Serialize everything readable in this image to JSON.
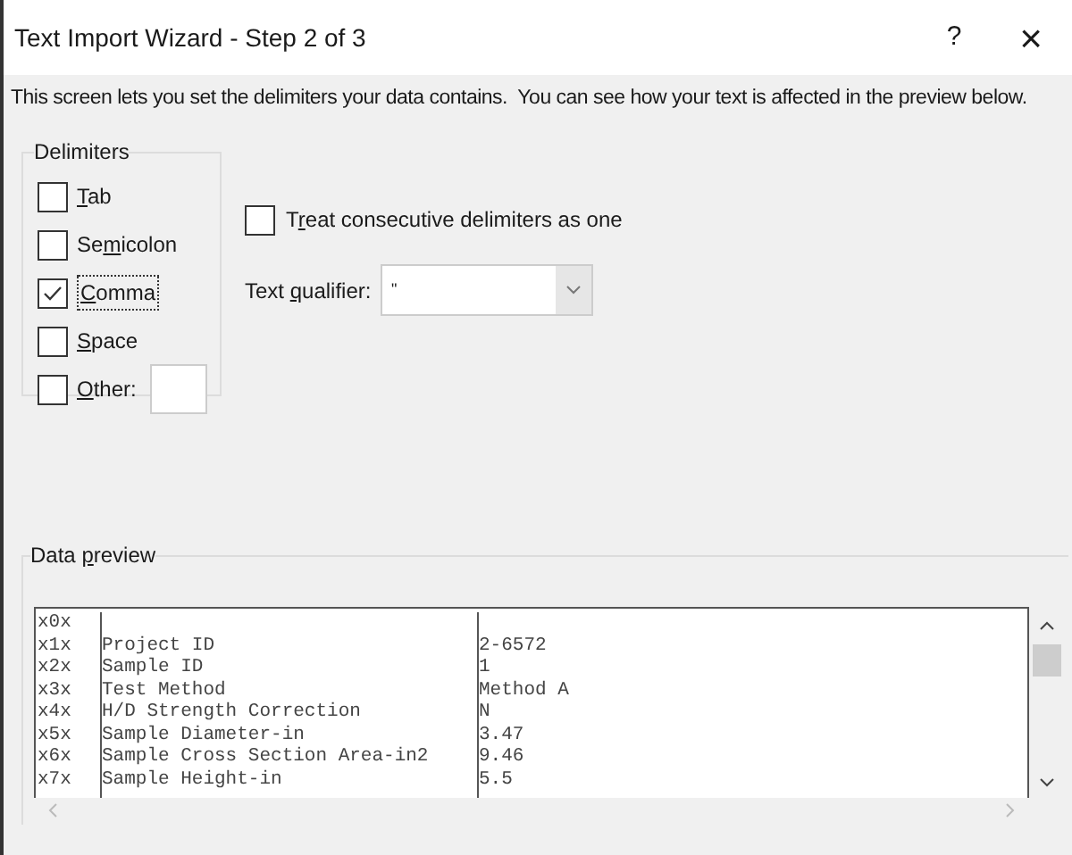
{
  "window": {
    "title": "Text Import Wizard - Step 2 of 3",
    "help": "?",
    "close": "×"
  },
  "description": "This screen lets you set the delimiters your data contains.  You can see how your text is affected in the preview below.",
  "delimiters": {
    "title": "Delimiters",
    "items": [
      {
        "key": "T",
        "after": "ab",
        "checked": false,
        "kind": "plain"
      },
      {
        "before": "Se",
        "key": "m",
        "after": "icolon",
        "checked": false,
        "kind": "plain"
      },
      {
        "key": "C",
        "after": "omma",
        "checked": true,
        "kind": "plain"
      },
      {
        "key": "S",
        "after": "pace",
        "checked": false,
        "kind": "plain"
      },
      {
        "key": "O",
        "after": "ther:",
        "checked": false,
        "kind": "with_field"
      }
    ]
  },
  "treat_consecutive": {
    "before": "T",
    "key": "r",
    "after": "eat consecutive delimiters as one",
    "checked": false
  },
  "text_qualifier": {
    "before": "Text ",
    "key": "q",
    "after": "ualifier:",
    "value": "\""
  },
  "preview": {
    "before": "Data ",
    "key": "p",
    "after": "review",
    "rows": [
      [
        "x0x",
        "",
        ""
      ],
      [
        "x1x",
        "Project ID",
        "2-6572"
      ],
      [
        "x2x",
        "Sample ID",
        "1"
      ],
      [
        "x3x",
        "Test Method",
        "Method A"
      ],
      [
        "x4x",
        "H/D Strength Correction",
        "N"
      ],
      [
        "x5x",
        "Sample Diameter-in",
        "3.47"
      ],
      [
        "x6x",
        "Sample Cross Section Area-in2",
        "9.46"
      ],
      [
        "x7x",
        "Sample Height-in",
        "5.5"
      ]
    ]
  }
}
